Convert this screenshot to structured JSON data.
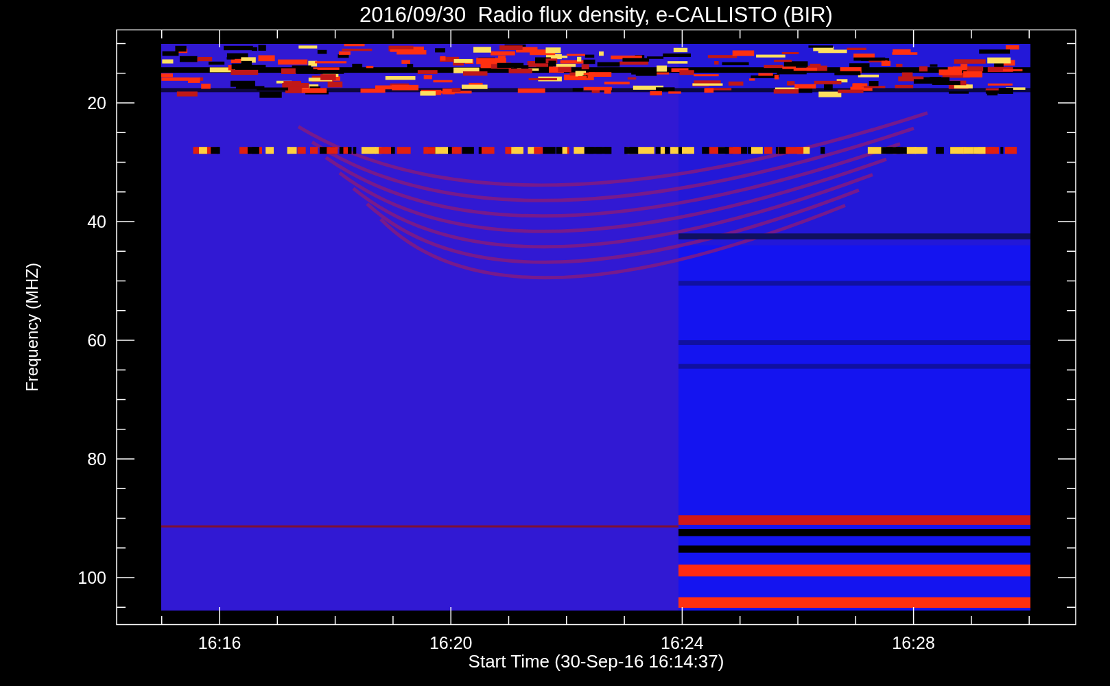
{
  "title": "2016/09/30  Radio flux density, e-CALLISTO (BIR)",
  "y_axis": {
    "label": "Frequency (MHZ)",
    "tick_labels": [
      "20",
      "40",
      "60",
      "80",
      "100"
    ]
  },
  "x_axis": {
    "label": "Start Time (30-Sep-16 16:14:37)",
    "tick_labels": [
      "16:16",
      "16:20",
      "16:24",
      "16:28"
    ]
  }
}
